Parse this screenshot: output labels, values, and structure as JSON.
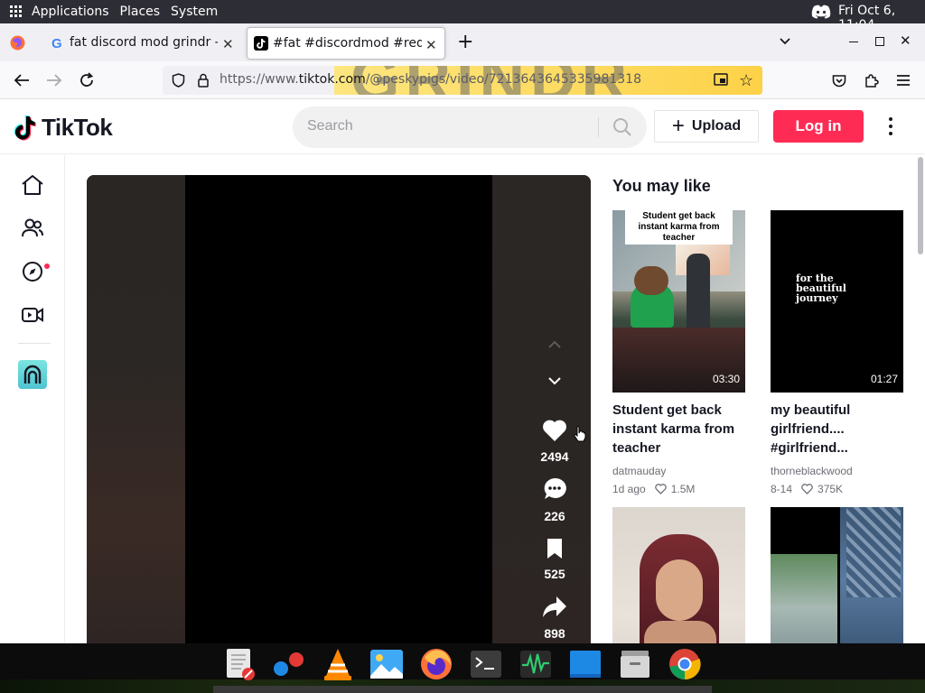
{
  "gnome_bar": {
    "applications": "Applications",
    "places": "Places",
    "system": "System",
    "clock": "Fri Oct  6, 11:04"
  },
  "browser": {
    "tabs": [
      {
        "label": "fat discord mod grindr - Goo",
        "active": false
      },
      {
        "label": "#fat #discordmod #reddit #",
        "active": true
      }
    ],
    "url_prefix": "https://www.",
    "url_domain": "tiktok.com",
    "url_path": "/@peskypigs/video/7213643645335981318",
    "banner_text": "GRINDR"
  },
  "tiktok": {
    "brand": "TikTok",
    "search_placeholder": "Search",
    "upload_label": "Upload",
    "login_label": "Log in",
    "video": {
      "likes": "2494",
      "comments": "226",
      "saves": "525",
      "shares": "898"
    },
    "recommended_title": "You may like",
    "cards": [
      {
        "overlay": "Student get back instant karma from teacher",
        "duration": "03:30",
        "title": "Student get back instant karma from teacher",
        "author": "datmauday",
        "date": "1d ago",
        "likes": "1.5M"
      },
      {
        "overlay": "for the beautiful journey",
        "duration": "01:27",
        "title": "my beautiful girlfriend.... #girlfriend...",
        "author": "thorneblackwood",
        "date": "8-14",
        "likes": "375K"
      },
      {
        "overlay": "",
        "duration": "",
        "title": "",
        "author": "",
        "date": "",
        "likes": ""
      },
      {
        "overlay": "",
        "duration": "",
        "title": "",
        "author": "",
        "date": "",
        "likes": ""
      }
    ]
  },
  "colors": {
    "accent": "#fe2c55",
    "gnome_bar": "#2d2d35",
    "tiktok_text": "#161823"
  }
}
